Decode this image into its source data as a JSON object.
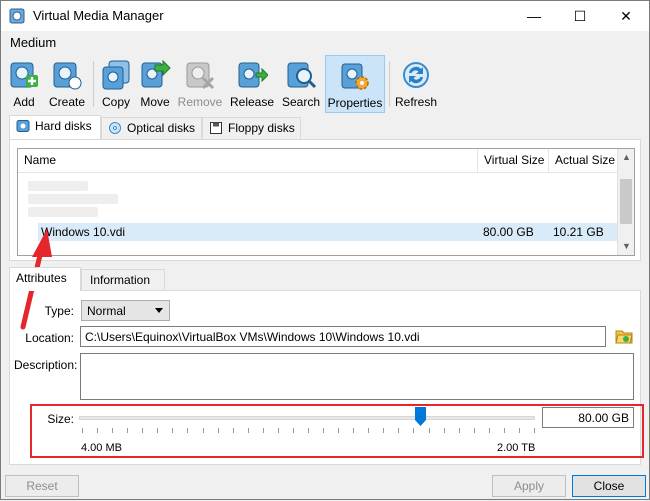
{
  "window": {
    "title": "Virtual Media Manager",
    "minimize_glyph": "—",
    "maximize_glyph": "☐",
    "close_glyph": "✕"
  },
  "menu": {
    "medium": "Medium"
  },
  "toolbar": {
    "add": "Add",
    "create": "Create",
    "copy": "Copy",
    "move": "Move",
    "remove": "Remove",
    "release": "Release",
    "search": "Search",
    "properties": "Properties",
    "refresh": "Refresh"
  },
  "media_tabs": {
    "hard_disks": "Hard disks",
    "optical_disks": "Optical disks",
    "floppy_disks": "Floppy disks"
  },
  "table": {
    "columns": {
      "name": "Name",
      "virtual_size": "Virtual Size",
      "actual_size": "Actual Size"
    },
    "sort_glyph": "^",
    "selected_row": {
      "name": "Windows 10.vdi",
      "virtual_size": "80.00 GB",
      "actual_size": "10.21 GB"
    }
  },
  "detail_tabs": {
    "attributes": "Attributes",
    "information": "Information"
  },
  "attributes": {
    "type_label": "Type:",
    "type_value": "Normal",
    "location_label": "Location:",
    "location_value": "C:\\Users\\Equinox\\VirtualBox VMs\\Windows 10\\Windows 10.vdi",
    "description_label": "Description:",
    "description_value": "",
    "size_label": "Size:",
    "size_value": "80.00 GB",
    "size_min": "4.00 MB",
    "size_max": "2.00 TB"
  },
  "buttons": {
    "reset": "Reset",
    "apply": "Apply",
    "close": "Close"
  },
  "colors": {
    "accent": "#0078d7",
    "annotation": "#e5262b",
    "selection": "#d9ebf9"
  }
}
